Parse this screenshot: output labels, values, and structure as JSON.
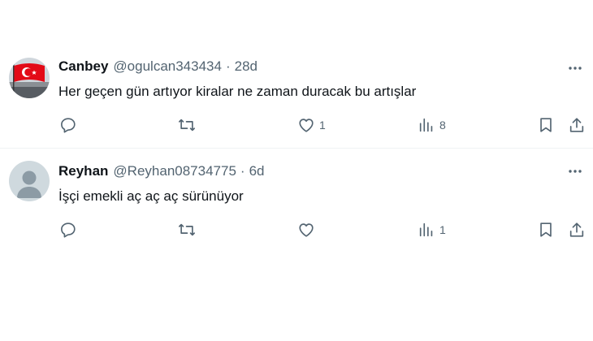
{
  "tweets": [
    {
      "name": "Canbey",
      "handle": "@ogulcan343434",
      "separator": "·",
      "time": "28d",
      "text": "Her geçen gün artıyor kiralar ne zaman duracak bu artışlar",
      "likes": "1",
      "views": "8",
      "avatar": "flag-avatar"
    },
    {
      "name": "Reyhan",
      "handle": "@Reyhan08734775",
      "separator": "·",
      "time": "6d",
      "text": "İşçi emekli aç aç aç sürünüyor",
      "likes": "",
      "views": "1",
      "avatar": "default-avatar"
    }
  ],
  "colors": {
    "text": "#0f1419",
    "secondary": "#536471",
    "divider": "#eff3f4",
    "flag_red": "#e30a17"
  }
}
